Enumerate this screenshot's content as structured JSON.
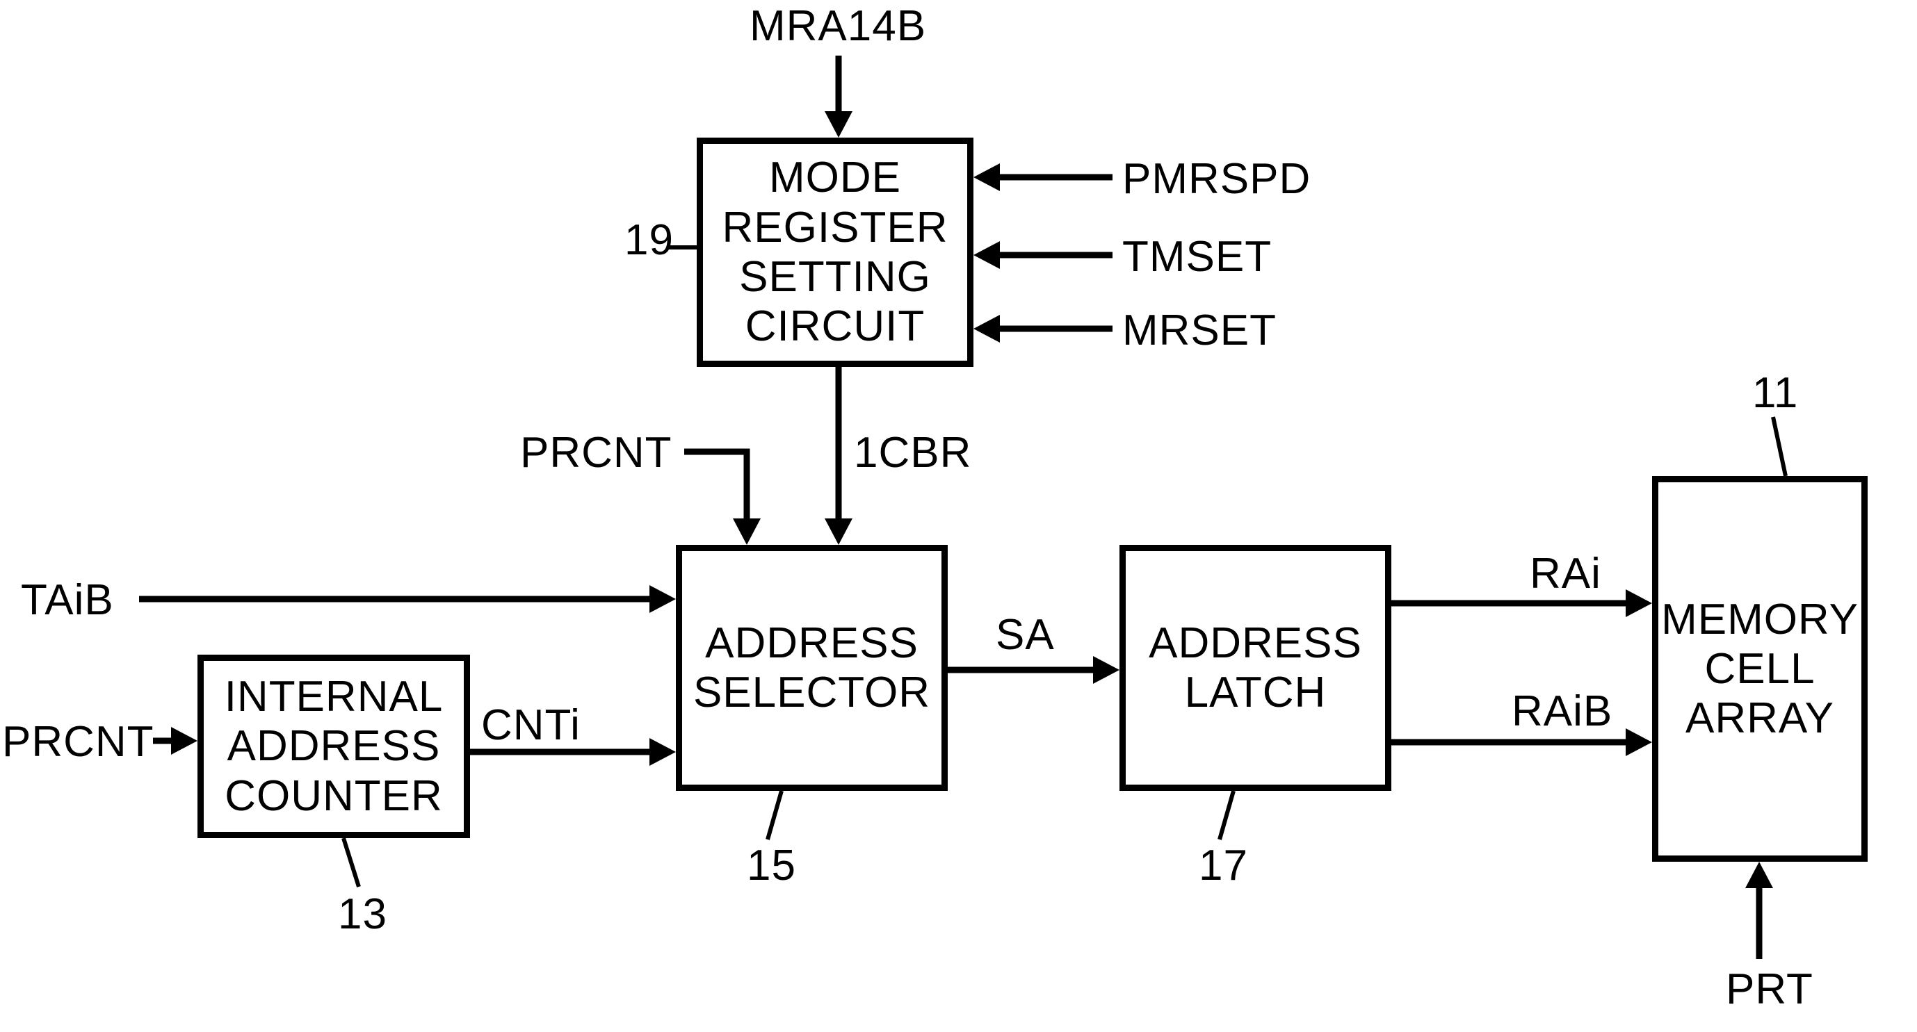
{
  "blocks": {
    "mode_register": {
      "text": "MODE\nREGISTER\nSETTING\nCIRCUIT",
      "ref": "19"
    },
    "internal_counter": {
      "text": "INTERNAL\nADDRESS\nCOUNTER",
      "ref": "13"
    },
    "address_selector": {
      "text": "ADDRESS\nSELECTOR",
      "ref": "15"
    },
    "address_latch": {
      "text": "ADDRESS\nLATCH",
      "ref": "17"
    },
    "memory_cell": {
      "text": "MEMORY\nCELL\nARRAY",
      "ref": "11"
    }
  },
  "signals": {
    "mra14b": "MRA14B",
    "pmrspd": "PMRSPD",
    "tmset": "TMSET",
    "mrset": "MRSET",
    "onecbr": "1CBR",
    "prcnt_top": "PRCNT",
    "prcnt_left": "PRCNT",
    "taib": "TAiB",
    "cnti": "CNTi",
    "sa": "SA",
    "rai": "RAi",
    "raib": "RAiB",
    "prt": "PRT"
  }
}
